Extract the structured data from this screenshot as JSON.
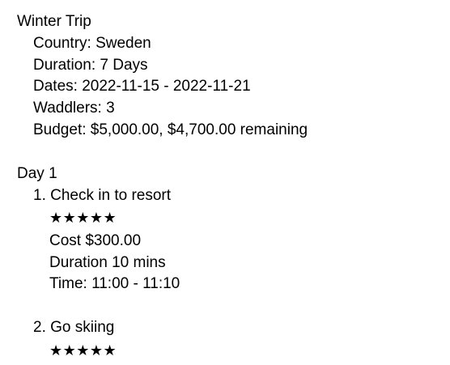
{
  "trip": {
    "title": "Winter Trip",
    "country": "Country: Sweden",
    "duration": "Duration: 7 Days",
    "dates": "Dates: 2022-11-15 - 2022-11-21",
    "waddlers": "Waddlers: 3",
    "budget": "Budget: $5,000.00, $4,700.00 remaining"
  },
  "days": [
    {
      "label": "Day 1",
      "activities": [
        {
          "title": "1. Check in to resort",
          "rating": 5,
          "stars": "★★★★★",
          "cost": "Cost $300.00",
          "duration": "Duration 10 mins",
          "time": "Time: 11:00 - 11:10"
        },
        {
          "title": "2. Go skiing",
          "rating": 5,
          "stars": "★★★★★"
        }
      ]
    }
  ]
}
